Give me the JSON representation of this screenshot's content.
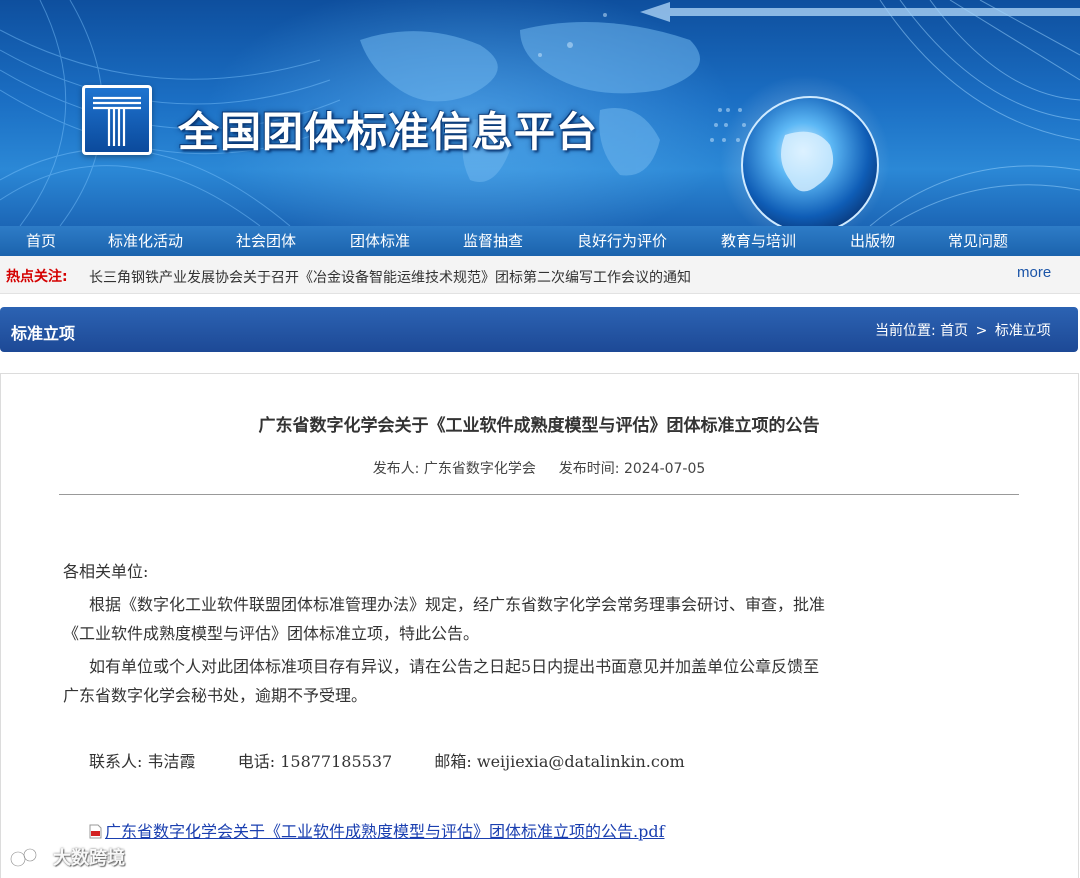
{
  "site": {
    "title": "全国团体标准信息平台"
  },
  "nav": {
    "items": [
      {
        "label": "首页"
      },
      {
        "label": "标准化活动"
      },
      {
        "label": "社会团体"
      },
      {
        "label": "团体标准"
      },
      {
        "label": "监督抽查"
      },
      {
        "label": "良好行为评价"
      },
      {
        "label": "教育与培训"
      },
      {
        "label": "出版物"
      },
      {
        "label": "常见问题"
      }
    ]
  },
  "hot": {
    "label": "热点关注:",
    "news": "长三角钢铁产业发展协会关于召开《冶金设备智能运维技术规范》团标第二次编写工作会议的通知",
    "more": "more"
  },
  "section": {
    "title": "标准立项",
    "breadcrumb_prefix": "当前位置:",
    "breadcrumb_home": "首页",
    "breadcrumb_sep": ">",
    "breadcrumb_current": "标准立项"
  },
  "article": {
    "title": "广东省数字化学会关于《工业软件成熟度模型与评估》团体标准立项的公告",
    "publisher_label": "发布人:",
    "publisher": "广东省数字化学会",
    "date_label": "发布时间:",
    "date": "2024-07-05",
    "salutation": "各相关单位:",
    "p1_line1": "根据《数字化工业软件联盟团体标准管理办法》规定，经广东省数字化学会常务理事会研讨、审查，批准",
    "p1_line2": "《工业软件成熟度模型与评估》团体标准立项，特此公告。",
    "p2_line1": "如有单位或个人对此团体标准项目存有异议，请在公告之日起5日内提出书面意见并加盖单位公章反馈至",
    "p2_line2": "广东省数字化学会秘书处，逾期不予受理。",
    "contact_label": "联系人:",
    "contact_name": "韦洁霞",
    "phone_label": "电话:",
    "phone": "15877185537",
    "email_label": "邮箱:",
    "email": "weijiexia@datalinkin.com",
    "attachment": "广东省数字化学会关于《工业软件成熟度模型与评估》团体标准立项的公告.pdf"
  },
  "watermark": {
    "text": "大数跨境"
  },
  "colors": {
    "nav_bg": "#1f68b3",
    "hot_label": "#d40000",
    "section_bg": "#24539f",
    "link": "#1a3fb0"
  }
}
